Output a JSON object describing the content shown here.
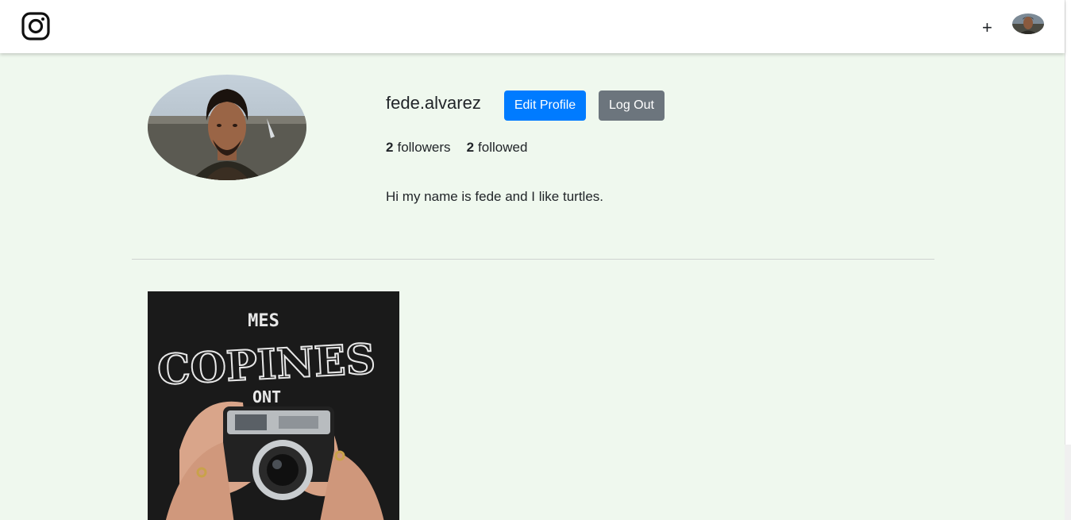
{
  "nav": {
    "logo_icon": "instagram-icon",
    "new_post_label": "+",
    "avatar_icon": "user-avatar"
  },
  "profile": {
    "username": "fede.alvarez",
    "edit_profile_label": "Edit Profile",
    "log_out_label": "Log Out",
    "followers_count": "2",
    "followers_label": "followers",
    "followed_count": "2",
    "followed_label": "followed",
    "bio": "Hi my name is fede and I like turtles."
  },
  "posts": [
    {
      "image": "camera-photo",
      "shirt_text_top": "MES",
      "shirt_text_main": "COPINES",
      "shirt_text_bottom": "ONT"
    }
  ],
  "colors": {
    "page_bg": "#eff8ee",
    "primary": "#007bff",
    "secondary": "#6c757d"
  }
}
